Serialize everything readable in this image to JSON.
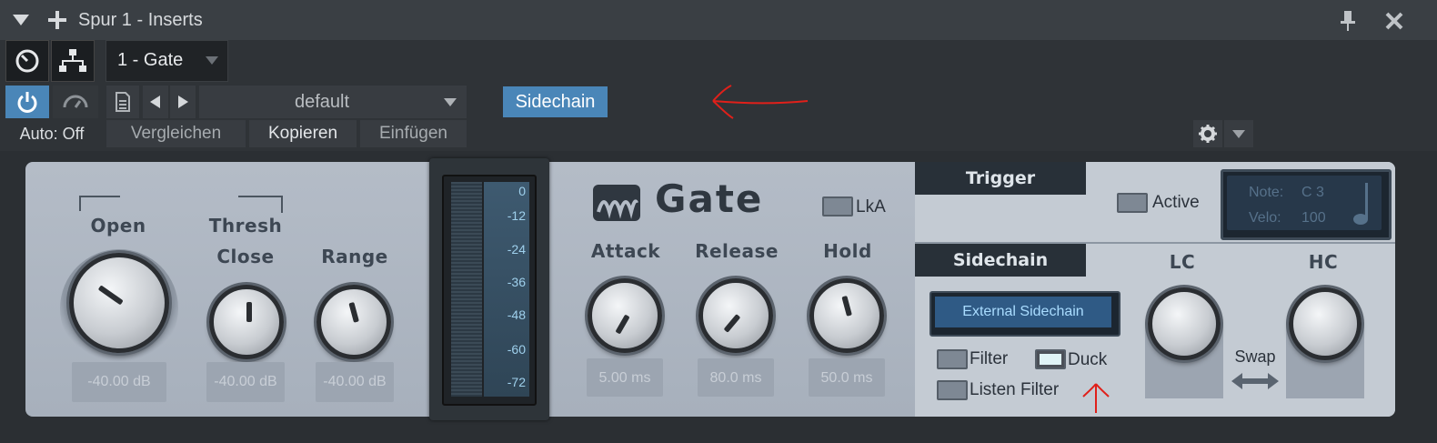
{
  "window": {
    "title": "Spur 1 - Inserts"
  },
  "preset_slot": {
    "name": "1 - Gate"
  },
  "toolbar": {
    "preset_name": "default",
    "sidechain_label": "Sidechain",
    "auto_label": "Auto: Off",
    "compare_label": "Vergleichen",
    "copy_label": "Kopieren",
    "paste_label": "Einfügen"
  },
  "plugin": {
    "title": "Gate",
    "lka_label": "LkA",
    "open_label": "Open",
    "thresh_label": "Thresh",
    "close_label": "Close",
    "range_label": "Range",
    "open_value": "-40.00 dB",
    "close_value": "-40.00 dB",
    "range_value": "-40.00 dB",
    "meter_ticks": [
      "0",
      "-12",
      "-24",
      "-36",
      "-48",
      "-60",
      "-72"
    ],
    "attack_label": "Attack",
    "release_label": "Release",
    "hold_label": "Hold",
    "attack_value": "5.00 ms",
    "release_value": "80.0 ms",
    "hold_value": "50.0 ms",
    "trigger_tab": "Trigger",
    "active_label": "Active",
    "note_label": "Note:",
    "note_value": "C 3",
    "velo_label": "Velo:",
    "velo_value": "100",
    "sidechain_tab": "Sidechain",
    "external_sidechain": "External Sidechain",
    "filter_label": "Filter",
    "duck_label": "Duck",
    "listen_filter_label": "Listen Filter",
    "lc_label": "LC",
    "hc_label": "HC",
    "swap_label": "Swap"
  },
  "colors": {
    "accent": "#4a86b8",
    "annotation": "#e0201a"
  }
}
